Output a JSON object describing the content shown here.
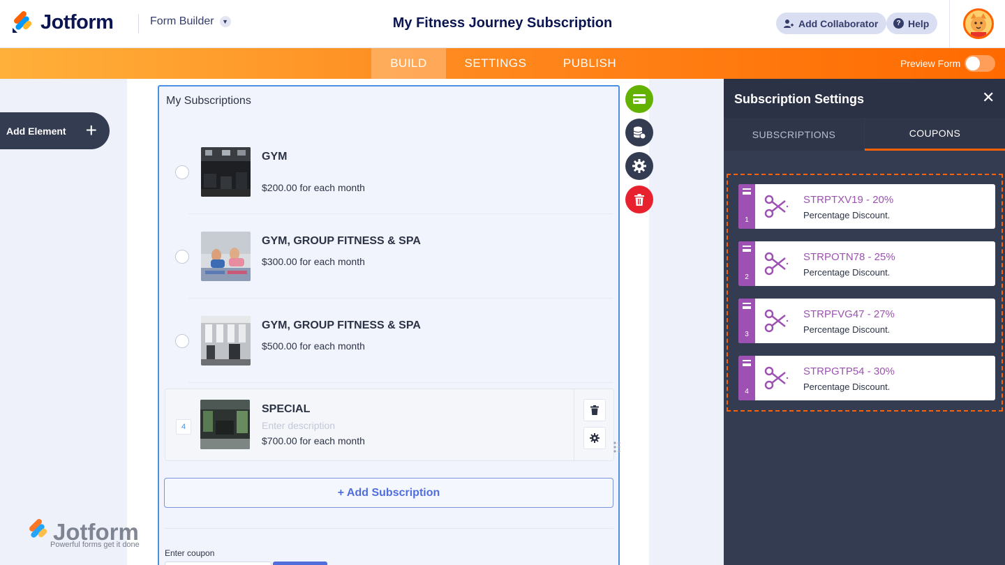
{
  "brand": {
    "name": "Jotform",
    "watermark_name": "Jotform",
    "watermark_tagline": "Powerful forms get it done"
  },
  "header": {
    "app_label": "Form Builder",
    "form_title": "My Fitness Journey Subscription",
    "collaborator_label": "Add Collaborator",
    "help_label": "Help"
  },
  "nav": {
    "tabs": [
      {
        "label": "BUILD",
        "active": true
      },
      {
        "label": "SETTINGS",
        "active": false
      },
      {
        "label": "PUBLISH",
        "active": false
      }
    ],
    "preview_label": "Preview Form",
    "preview_enabled": false
  },
  "sidebar": {
    "add_element_label": "Add Element"
  },
  "form": {
    "field_title": "My Subscriptions",
    "subscriptions": [
      {
        "name": "GYM",
        "price": "$200.00 for each month"
      },
      {
        "name": "GYM, GROUP FITNESS & SPA",
        "price": "$300.00 for each month"
      },
      {
        "name": "GYM, GROUP FITNESS & SPA",
        "price": "$500.00 for each month"
      },
      {
        "number": "4",
        "name": "SPECIAL",
        "description_placeholder": "Enter description",
        "price": "$700.00 for each month"
      }
    ],
    "add_subscription_label": "+ Add Subscription",
    "coupon_label": "Enter coupon"
  },
  "panel": {
    "title": "Subscription Settings",
    "tabs": [
      {
        "label": "SUBSCRIPTIONS",
        "active": false
      },
      {
        "label": "COUPONS",
        "active": true
      }
    ],
    "coupons": [
      {
        "index": "1",
        "code": "STRPTXV19 - 20%",
        "type": "Percentage Discount."
      },
      {
        "index": "2",
        "code": "STRPOTN78 - 25%",
        "type": "Percentage Discount."
      },
      {
        "index": "3",
        "code": "STRPFVG47 - 27%",
        "type": "Percentage Discount."
      },
      {
        "index": "4",
        "code": "STRPGTP54 - 30%",
        "type": "Percentage Discount."
      }
    ]
  },
  "colors": {
    "accent_orange": "#ff6100",
    "coupon_purple": "#9d51b2",
    "panel_dark": "#343c52",
    "field_blue": "#4a90e2",
    "tool_green": "#64b200",
    "tool_red": "#e8212f"
  },
  "icons": {
    "tools": [
      "payment-card-icon",
      "database-icon",
      "gear-icon",
      "trash-icon"
    ],
    "coupon": "scissors-icon"
  }
}
